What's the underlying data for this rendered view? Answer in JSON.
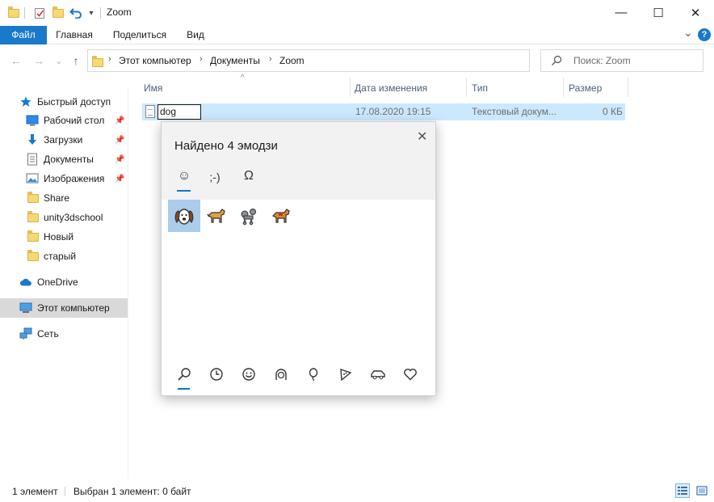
{
  "window": {
    "title": "Zoom",
    "minimize_glyph": "—",
    "maximize_glyph": "☐",
    "close_glyph": "✕",
    "quick_access_dropdown_glyph": "▾"
  },
  "ribbon": {
    "tabs": [
      {
        "label": "Файл"
      },
      {
        "label": "Главная"
      },
      {
        "label": "Поделиться"
      },
      {
        "label": "Вид"
      }
    ],
    "expand_glyph": "⌄",
    "help_glyph": "?"
  },
  "nav": {
    "back_glyph": "←",
    "forward_glyph": "→",
    "recent_glyph": "⌄",
    "up_glyph": "↑",
    "breadcrumb": [
      "Этот компьютер",
      "Документы",
      "Zoom"
    ],
    "breadcrumb_separator": "›",
    "dropdown_glyph": "⌄",
    "refresh_glyph": "↻",
    "search_placeholder": "Поиск: Zoom"
  },
  "sidebar": {
    "items": [
      {
        "label": "Быстрый доступ",
        "icon": "star-icon",
        "pinned": false
      },
      {
        "label": "Рабочий стол",
        "icon": "desktop-icon",
        "pinned": true
      },
      {
        "label": "Загрузки",
        "icon": "download-icon",
        "pinned": true
      },
      {
        "label": "Документы",
        "icon": "document-icon",
        "pinned": true
      },
      {
        "label": "Изображения",
        "icon": "pictures-icon",
        "pinned": true
      },
      {
        "label": "Share",
        "icon": "folder-icon",
        "pinned": false
      },
      {
        "label": "unity3dschool",
        "icon": "folder-icon",
        "pinned": false
      },
      {
        "label": "Новый",
        "icon": "folder-icon",
        "pinned": false
      },
      {
        "label": "старый",
        "icon": "folder-icon",
        "pinned": false
      },
      {
        "label": "OneDrive",
        "icon": "cloud-icon",
        "pinned": false
      },
      {
        "label": "Этот компьютер",
        "icon": "computer-icon",
        "pinned": false
      },
      {
        "label": "Сеть",
        "icon": "network-icon",
        "pinned": false
      }
    ],
    "pin_glyph": "📌"
  },
  "file_list": {
    "columns": [
      "Имя",
      "Дата изменения",
      "Тип",
      "Размер"
    ],
    "sort_glyph": "^",
    "rows": [
      {
        "name": "dog",
        "date": "17.08.2020 19:15",
        "type": "Текстовый докум...",
        "size": "0 КБ"
      }
    ]
  },
  "emoji_panel": {
    "title": "Найдено 4 эмодзи",
    "close_glyph": "✕",
    "categories": [
      {
        "label": "☺",
        "icon": "emoji-tab-icon"
      },
      {
        "label": ";-)",
        "icon": "kaomoji-tab-icon"
      },
      {
        "label": "Ω",
        "icon": "symbols-tab-icon"
      }
    ],
    "results": [
      "🐶",
      "🐕",
      "🐩",
      "🐕"
    ],
    "bottom_icons": [
      "search-icon",
      "recent-icon",
      "smiley-icon",
      "people-icon",
      "celebration-icon",
      "food-icon",
      "travel-icon",
      "heart-icon"
    ]
  },
  "status": {
    "count": "1 элемент",
    "selected": "Выбран 1 элемент: 0 байт"
  },
  "colors": {
    "accent": "#1979ca",
    "selection": "#cce8ff",
    "emoji_selected": "#a9cdeb",
    "underline": "#0078d4"
  }
}
